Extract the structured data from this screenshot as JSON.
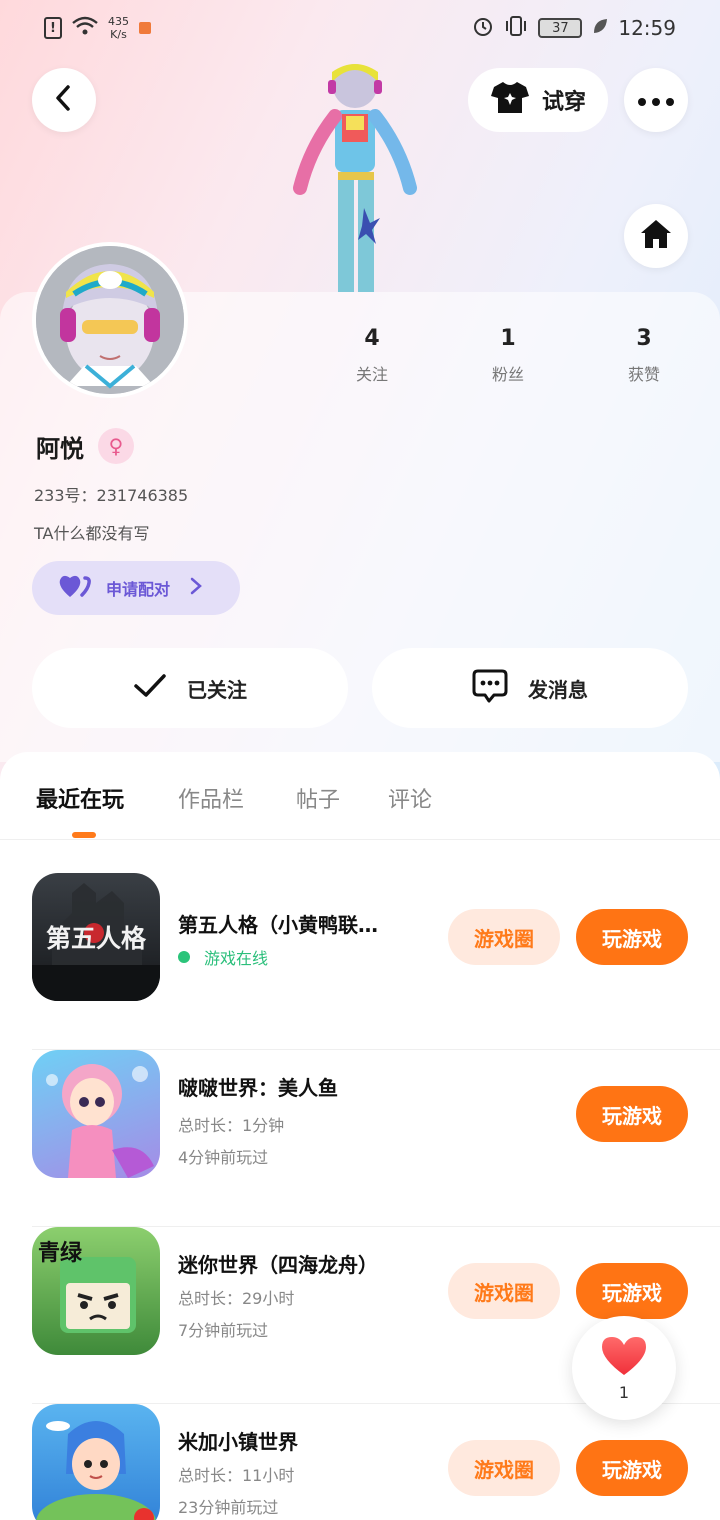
{
  "status_bar": {
    "speed_value": "435",
    "speed_unit": "K/s",
    "battery": "37",
    "time": "12:59"
  },
  "header": {
    "try_on_label": "试穿"
  },
  "profile": {
    "name": "阿悦",
    "gender_symbol": "♀",
    "uid_label": "233号：",
    "uid_value": "231746385",
    "bio": "TA什么都没有写",
    "match_label": "申请配对"
  },
  "stats": [
    {
      "value": "4",
      "label": "关注"
    },
    {
      "value": "1",
      "label": "粉丝"
    },
    {
      "value": "3",
      "label": "获赞"
    }
  ],
  "actions": {
    "follow_label": "已关注",
    "message_label": "发消息"
  },
  "tabs": [
    {
      "label": "最近在玩",
      "active": true
    },
    {
      "label": "作品栏",
      "active": false
    },
    {
      "label": "帖子",
      "active": false
    },
    {
      "label": "评论",
      "active": false
    }
  ],
  "games": [
    {
      "title": "第五人格（小黄鸭联…",
      "status": "游戏在线",
      "circle_label": "游戏圈",
      "play_label": "玩游戏"
    },
    {
      "title": "啵啵世界：美人鱼",
      "duration": "总时长：1分钟",
      "last_played": "4分钟前玩过",
      "play_label": "玩游戏"
    },
    {
      "title": "迷你世界（四海龙舟）",
      "duration": "总时长：29小时",
      "last_played": "7分钟前玩过",
      "circle_label": "游戏圈",
      "play_label": "玩游戏"
    },
    {
      "title": "米加小镇世界",
      "duration": "总时长：11小时",
      "last_played": "23分钟前玩过",
      "circle_label": "游戏圈",
      "play_label": "玩游戏"
    }
  ],
  "game_icon_text": {
    "identity_v": "第五人格",
    "mini_world": "青绿"
  },
  "like": {
    "count": "1"
  },
  "colors": {
    "accent": "#ff7414",
    "accent_light": "#ffe9de",
    "online": "#2bc47a",
    "match_text": "#6b58d6",
    "match_bg": "#e4dff8"
  }
}
